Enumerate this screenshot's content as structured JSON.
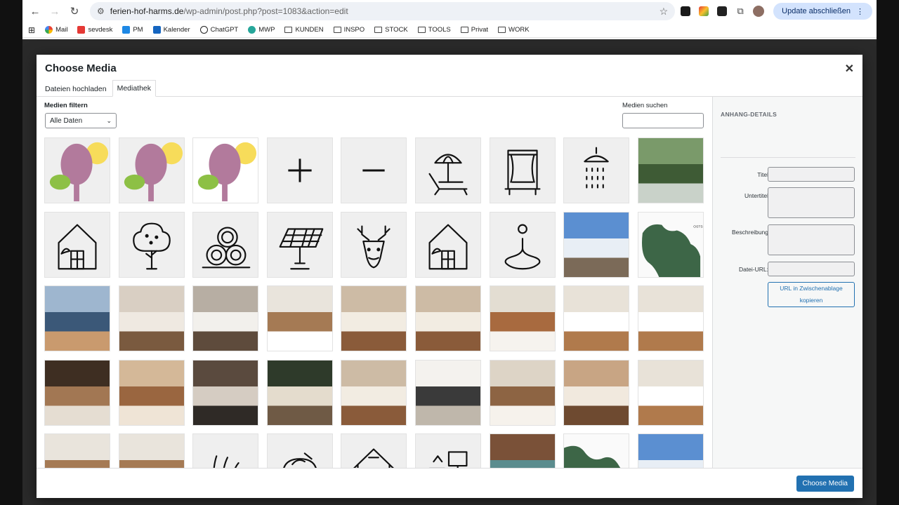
{
  "browser": {
    "url_host": "ferien-hof-harms.de",
    "url_path": "/wp-admin/post.php?post=1083&action=edit",
    "update_label": "Update abschließen",
    "bookmarks": [
      "Mail",
      "sevdesk",
      "PM",
      "Kalender",
      "ChatGPT",
      "MWP",
      "KUNDEN",
      "INSPO",
      "STOCK",
      "TOOLS",
      "Privat",
      "WORK"
    ]
  },
  "modal": {
    "title": "Choose Media",
    "tabs": [
      "Dateien hochladen",
      "Mediathek"
    ],
    "active_tab": "Mediathek",
    "filter_label": "Medien filtern",
    "filter_value": "Alle Daten",
    "search_label": "Medien suchen",
    "choose_button": "Choose Media"
  },
  "sidebar": {
    "title": "ANHANG-DETAILS",
    "fields": {
      "title": "Titel",
      "subtitle": "Untertitel",
      "description": "Beschreibung",
      "file_url": "Datei-URL:"
    },
    "copy_button": "URL in Zwischenablage kopieren"
  },
  "colors": {
    "accent": "#2271b1",
    "chrome_update": "#d3e3fd"
  },
  "media_tiles": [
    "tree-icon-pink",
    "tree-icon-pink",
    "tree-icon-pink-white",
    "plus-icon",
    "minus-icon",
    "beach-chair-icon",
    "window-icon",
    "shower-icon",
    "photo-house-garden",
    "eco-house-icon",
    "tree-icon",
    "hay-bales-icon",
    "solar-panel-icon",
    "deer-icon",
    "eco-house-icon",
    "water-drop-icon",
    "photo-snow-house",
    "map-island",
    "photo-cruise-ship",
    "photo-sofa",
    "photo-kitchen",
    "photo-bedroom",
    "photo-living-room",
    "photo-living-room",
    "photo-kitchen-dining",
    "photo-bedroom-attic",
    "photo-bedroom-attic",
    "photo-stairs",
    "photo-dining",
    "photo-sofa-dark",
    "photo-armchair",
    "photo-living-room",
    "photo-kitchen-white",
    "photo-living-kitchen",
    "photo-attic-living",
    "photo-bedroom-attic",
    "photo-bedroom",
    "photo-bedroom",
    "grass-icon",
    "bowl-icon",
    "house-icon",
    "workspace-icon",
    "photo-woman-deck",
    "map-ostsee",
    "photo-snow-house"
  ]
}
